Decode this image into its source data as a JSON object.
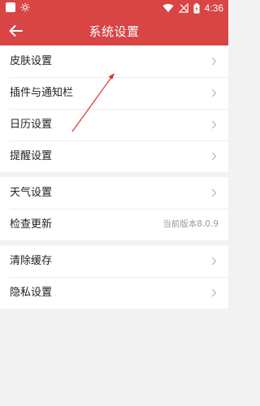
{
  "status_bar": {
    "time": "4:36",
    "icons": [
      "notification-square-icon",
      "brightness-icon",
      "wifi-icon",
      "no-signal-icon",
      "battery-charging-icon"
    ]
  },
  "header": {
    "title": "系统设置",
    "back_icon": "arrow-left-icon"
  },
  "groups": [
    {
      "items": [
        {
          "label": "皮肤设置",
          "chevron": true
        },
        {
          "label": "插件与通知栏",
          "chevron": true
        },
        {
          "label": "日历设置",
          "chevron": true
        },
        {
          "label": "提醒设置",
          "chevron": true
        }
      ]
    },
    {
      "items": [
        {
          "label": "天气设置",
          "chevron": true
        },
        {
          "label": "检查更新",
          "value": "当前版本8.0.9"
        }
      ]
    },
    {
      "items": [
        {
          "label": "清除缓存",
          "chevron": true
        },
        {
          "label": "隐私设置",
          "chevron": true
        }
      ]
    }
  ],
  "colors": {
    "accent": "#d94444",
    "background": "#f2f2f2",
    "annotation_arrow": "#e03030"
  }
}
